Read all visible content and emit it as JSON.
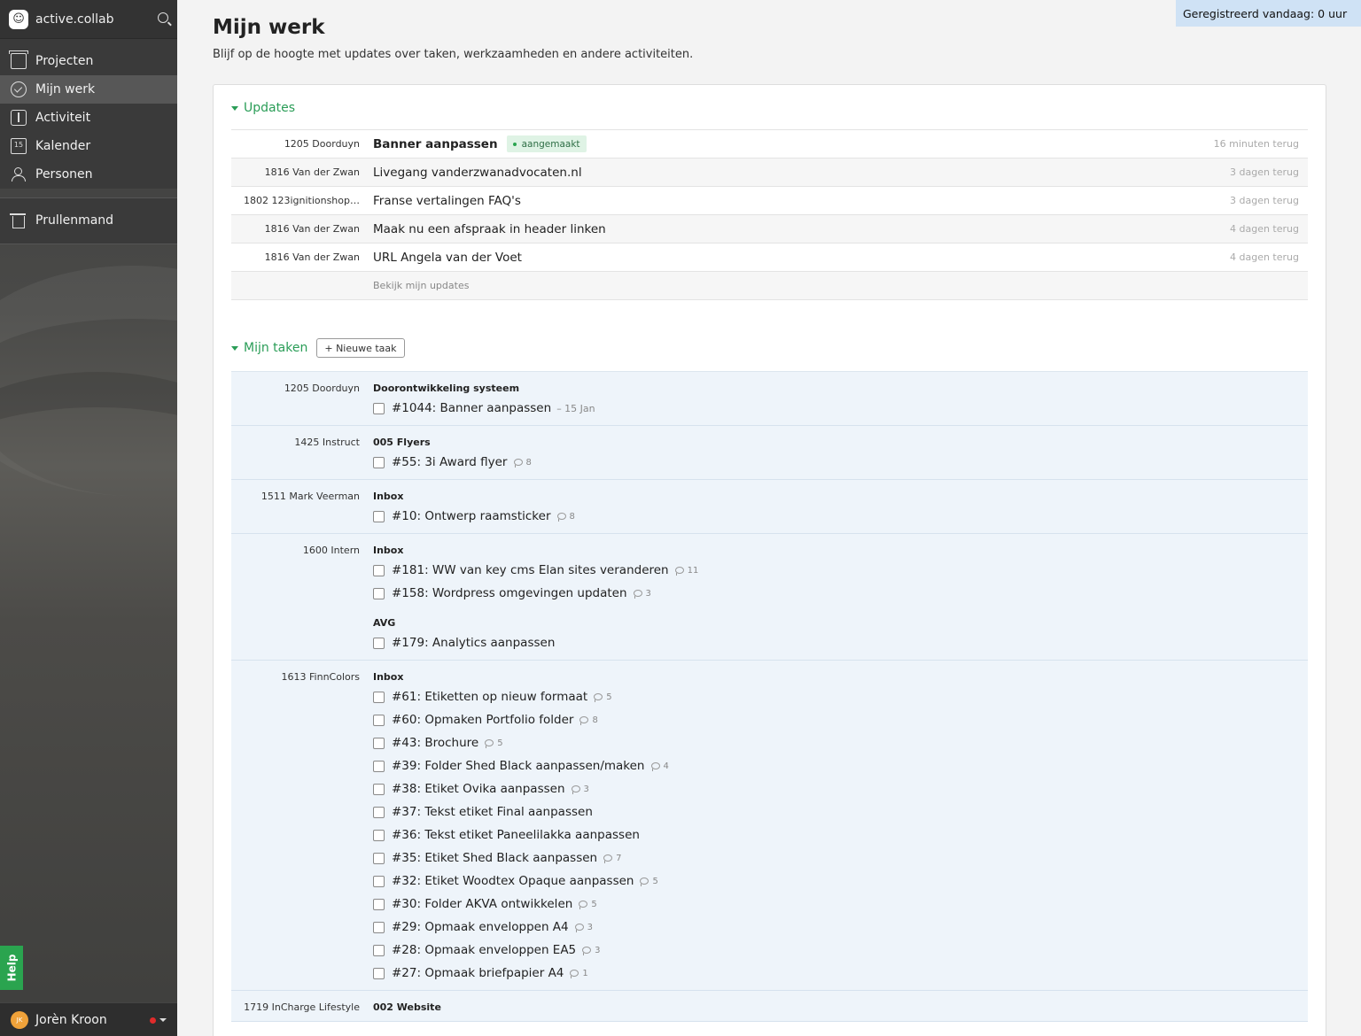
{
  "sidebar": {
    "brand": "active.collab",
    "nav": [
      {
        "label": "Projecten",
        "icon": "archive-icon"
      },
      {
        "label": "Mijn werk",
        "icon": "check-circle-icon"
      },
      {
        "label": "Activiteit",
        "icon": "activity-icon"
      },
      {
        "label": "Kalender",
        "icon": "calendar-icon"
      },
      {
        "label": "Personen",
        "icon": "people-icon"
      }
    ],
    "trash": "Prullenmand",
    "calendar_day": "15",
    "help": "Help",
    "user": {
      "initials": "JK",
      "name": "Jorèn Kroon"
    }
  },
  "header": {
    "registered": "Geregistreerd vandaag: 0 uur",
    "title": "Mijn werk",
    "subtitle": "Blijf op de hoogte met updates over taken, werkzaamheden en andere activiteiten."
  },
  "updates": {
    "heading": "Updates",
    "rows": [
      {
        "project": "1205 Doorduyn",
        "title": "Banner aanpassen",
        "badge": "aangemaakt",
        "time": "16 minuten terug"
      },
      {
        "project": "1816 Van der Zwan",
        "title": "Livegang vanderzwanadvocaten.nl",
        "time": "3 dagen terug"
      },
      {
        "project": "1802 123ignitionshop…",
        "title": "Franse vertalingen FAQ's",
        "time": "3 dagen terug"
      },
      {
        "project": "1816 Van der Zwan",
        "title": "Maak nu een afspraak in header linken",
        "time": "4 dagen terug"
      },
      {
        "project": "1816 Van der Zwan",
        "title": "URL Angela van der Voet",
        "time": "4 dagen terug"
      }
    ],
    "more": "Bekijk mijn updates"
  },
  "tasks": {
    "heading": "Mijn taken",
    "new_task": "+ Nieuwe taak",
    "g1": {
      "project": "1205 Doorduyn",
      "list": "Doorontwikkeling systeem",
      "items": [
        {
          "title": "#1044: Banner aanpassen",
          "due": "– 15 Jan"
        }
      ]
    },
    "g2": {
      "project": "1425 Instruct",
      "list": "005 Flyers",
      "items": [
        {
          "title": "#55: 3i Award flyer",
          "comments": "8"
        }
      ]
    },
    "g3": {
      "project": "1511 Mark Veerman",
      "list": "Inbox",
      "items": [
        {
          "title": "#10: Ontwerp raamsticker",
          "comments": "8"
        }
      ]
    },
    "g4": {
      "project": "1600 Intern",
      "list": "Inbox",
      "items": [
        {
          "title": "#181: WW van key cms Elan sites veranderen",
          "comments": "11"
        },
        {
          "title": "#158: Wordpress omgevingen updaten",
          "comments": "3"
        }
      ],
      "list2": "AVG",
      "items2": [
        {
          "title": "#179: Analytics aanpassen"
        }
      ]
    },
    "g5": {
      "project": "1613 FinnColors",
      "list": "Inbox",
      "items": [
        {
          "title": "#61: Etiketten op nieuw formaat",
          "comments": "5"
        },
        {
          "title": "#60: Opmaken Portfolio folder",
          "comments": "8"
        },
        {
          "title": "#43: Brochure",
          "comments": "5"
        },
        {
          "title": "#39: Folder Shed Black aanpassen/maken",
          "comments": "4"
        },
        {
          "title": "#38: Etiket Ovika aanpassen",
          "comments": "3"
        },
        {
          "title": "#37: Tekst etiket Final aanpassen"
        },
        {
          "title": "#36: Tekst etiket Paneelilakka aanpassen"
        },
        {
          "title": "#35: Etiket Shed Black aanpassen",
          "comments": "7"
        },
        {
          "title": "#32: Etiket Woodtex Opaque aanpassen",
          "comments": "5"
        },
        {
          "title": "#30: Folder AKVA ontwikkelen",
          "comments": "5"
        },
        {
          "title": "#29: Opmaak enveloppen A4",
          "comments": "3"
        },
        {
          "title": "#28: Opmaak enveloppen EA5",
          "comments": "3"
        },
        {
          "title": "#27: Opmaak briefpapier A4",
          "comments": "1"
        }
      ]
    },
    "g6": {
      "project": "1719 InCharge Lifestyle",
      "list": "002 Website"
    }
  },
  "colors": {
    "accent": "#2a9d57",
    "task_bg": "#eef4fa",
    "registered_bg": "#cfe2f5"
  }
}
